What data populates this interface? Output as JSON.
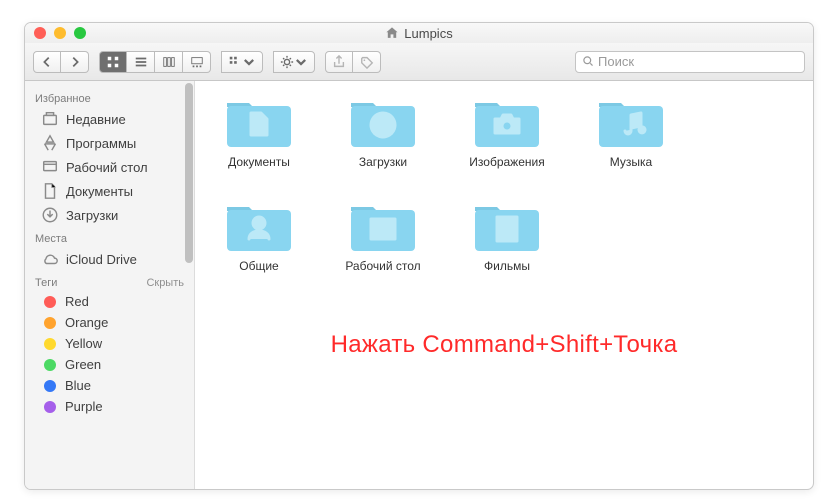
{
  "window": {
    "title": "Lumpics"
  },
  "traffic": {
    "close": "#ff5f57",
    "min": "#febc2e",
    "max": "#28c840"
  },
  "search": {
    "placeholder": "Поиск"
  },
  "sidebar": {
    "favorites_label": "Избранное",
    "items": [
      {
        "label": "Недавние"
      },
      {
        "label": "Программы"
      },
      {
        "label": "Рабочий стол"
      },
      {
        "label": "Документы"
      },
      {
        "label": "Загрузки"
      }
    ],
    "locations_label": "Места",
    "locations": [
      {
        "label": "iCloud Drive"
      }
    ],
    "tags_label": "Теги",
    "tags_hide": "Скрыть",
    "tags": [
      {
        "label": "Red",
        "color": "#ff5c57"
      },
      {
        "label": "Orange",
        "color": "#ffa32e"
      },
      {
        "label": "Yellow",
        "color": "#ffd92e"
      },
      {
        "label": "Green",
        "color": "#4cd964"
      },
      {
        "label": "Blue",
        "color": "#3478f6"
      },
      {
        "label": "Purple",
        "color": "#a55fea"
      }
    ]
  },
  "folders": [
    {
      "label": "Документы",
      "glyph": "doc"
    },
    {
      "label": "Загрузки",
      "glyph": "arrow-down-circle"
    },
    {
      "label": "Изображения",
      "glyph": "camera"
    },
    {
      "label": "Музыка",
      "glyph": "music"
    },
    {
      "label": "Общие",
      "glyph": "person"
    },
    {
      "label": "Рабочий стол",
      "glyph": "window"
    },
    {
      "label": "Фильмы",
      "glyph": "film"
    }
  ],
  "annotation": "Нажать Command+Shift+Точка"
}
